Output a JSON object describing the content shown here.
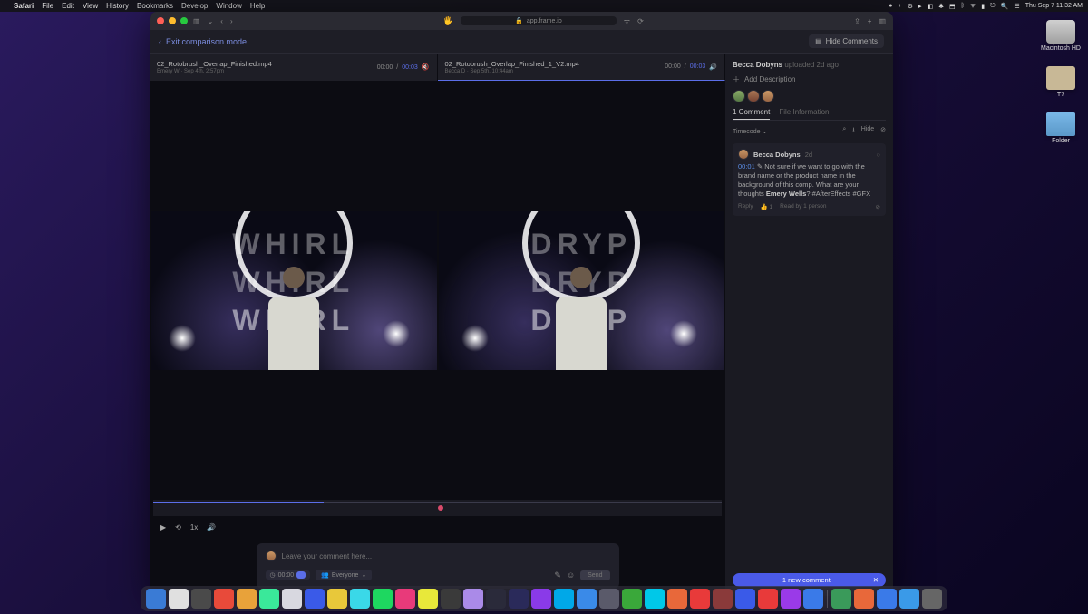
{
  "menubar": {
    "app": "Safari",
    "items": [
      "File",
      "Edit",
      "View",
      "History",
      "Bookmarks",
      "Develop",
      "Window",
      "Help"
    ],
    "clock": "Thu Sep 7  11:32 AM"
  },
  "browser": {
    "url": "app.frame.io"
  },
  "header": {
    "exit": "Exit comparison mode",
    "hide": "Hide Comments"
  },
  "files": [
    {
      "name": "02_Rotobrush_Overlap_Finished.mp4",
      "meta": "Emery W · Sep 4th, 2:57pm",
      "current": "00:00",
      "total": "00:03"
    },
    {
      "name": "02_Rotobrush_Overlap_Finished_1_V2.mp4",
      "meta": "Becca D · Sep 5th, 10:44am",
      "current": "00:00",
      "total": "00:03"
    }
  ],
  "videoText": {
    "left": "WHIRL",
    "right": "DRYP"
  },
  "controls": {
    "speed": "1x"
  },
  "commentBox": {
    "placeholder": "Leave your comment here...",
    "timecode": "00:00",
    "audience": "Everyone",
    "send": "Send"
  },
  "sidebar": {
    "uploader": "Becca Dobyns",
    "uploadedMeta": "uploaded 2d ago",
    "addDesc": "Add Description",
    "tabs": [
      "1 Comment",
      "File Information"
    ],
    "sort": "Timecode",
    "hide": "Hide",
    "comment": {
      "author": "Becca Dobyns",
      "age": "2d",
      "tc": "00:01",
      "body": "Not sure if we want to go with the brand name or the product name in the background of this comp. What are your thoughts ",
      "mention": "Emery Wells",
      "tags": "? #AfterEffects #GFX",
      "reply": "Reply",
      "likes": "1",
      "read": "Read by 1 person"
    },
    "newComment": "1 new comment"
  },
  "desktop": {
    "hd": "Macintosh HD",
    "t7": "T7",
    "folder": "Folder"
  },
  "dockColors": [
    "#3a7bd5",
    "#e0e0e0",
    "#4a4a4a",
    "#e84a3a",
    "#e8a23a",
    "#3ae89a",
    "#d8d8e0",
    "#3a5ae8",
    "#e8c83a",
    "#3ad8e8",
    "#1ed760",
    "#e83a7a",
    "#e8e83a",
    "#3a3a3a",
    "#aa8ae8",
    "#2a2a3a",
    "#2a2a5a",
    "#8a3ae8",
    "#00a8e8",
    "#3a8ae8",
    "#5a5a6a",
    "#3aa83a",
    "#00c8e8",
    "#e8683a",
    "#e83a3a",
    "#8a3a3a",
    "#3a5ae8",
    "#e83a3a",
    "#9a3ae8",
    "#3a7ae8",
    "#3a9a5a",
    "#e8683a",
    "#3a7ae8",
    "#3a9ae8",
    "#666"
  ]
}
